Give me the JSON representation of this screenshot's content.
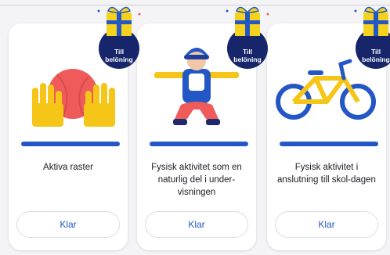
{
  "cards": [
    {
      "title": "Aktiva raster",
      "button_label": "Klar",
      "badge_line1": "Till",
      "badge_line2": "belöning"
    },
    {
      "title": "Fysisk aktivitet som en naturlig del i under-visningen",
      "button_label": "Klar",
      "badge_line1": "Till",
      "badge_line2": "belöning"
    },
    {
      "title": "Fysisk aktivitet i anslutning till skol-dagen",
      "button_label": "Klar",
      "badge_line1": "Till",
      "badge_line2": "belöning"
    }
  ],
  "colors": {
    "accent_blue": "#2457c6",
    "badge_navy": "#17256b",
    "gift_yellow": "#f5d21b",
    "ball_red": "#ef5b5b"
  },
  "icons": [
    "hands-ball-icon",
    "squatting-person-icon",
    "bicycle-icon",
    "gift-icon"
  ]
}
